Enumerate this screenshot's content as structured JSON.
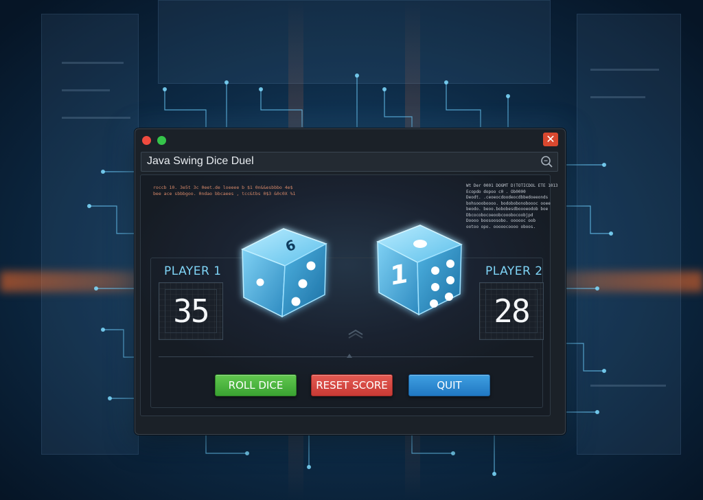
{
  "window": {
    "title": "Java Swing Dice Duel"
  },
  "code_snippets": {
    "top_left_1": "roccb 10. 3e5t 3c 0eet.de loeeee b $1 0n&&esbbbo 4e$",
    "top_left_2": "bee ace sbbbgoo. 0ndao bbcaees , tcc&tbs 0$3 &0c0X %1",
    "top_right_1": "Wt Der 0001 DOGMT D)TOTICDOL ETE 1013",
    "top_right_2": "Ecopdo dopoo c0 . Ob0000",
    "top_right_3": "Deodt. .ceoeocdoodeocdbbedoeeonds",
    "top_right_4": "bohsoooboooo. bodobobonoboooc ooee",
    "top_right_5": "beodo. beoo.bobobesdboooeodob boe",
    "top_right_6": "Dbcocobocoeoobcooobocoobjpd",
    "top_right_7": "Doooo boosoosobo. oooooc oob",
    "top_right_8": "ootoo opo. ooooocoooo oboos."
  },
  "player1": {
    "label": "PLAYER 1",
    "score": "35"
  },
  "player2": {
    "label": "PLAYER 2",
    "score": "28"
  },
  "dice": {
    "left_value": 6,
    "left_face_label": "6",
    "right_value": 1,
    "right_face_label": "1"
  },
  "buttons": {
    "roll_label": "ROLL DICE",
    "reset_label": "RESET SCORE",
    "quit_label": "QUIT"
  },
  "colors": {
    "accent_cyan": "#7fd4f6",
    "roll_green": "#3aa232",
    "reset_red": "#c83a35",
    "quit_blue": "#2178c3",
    "close_red": "#d9482f"
  }
}
